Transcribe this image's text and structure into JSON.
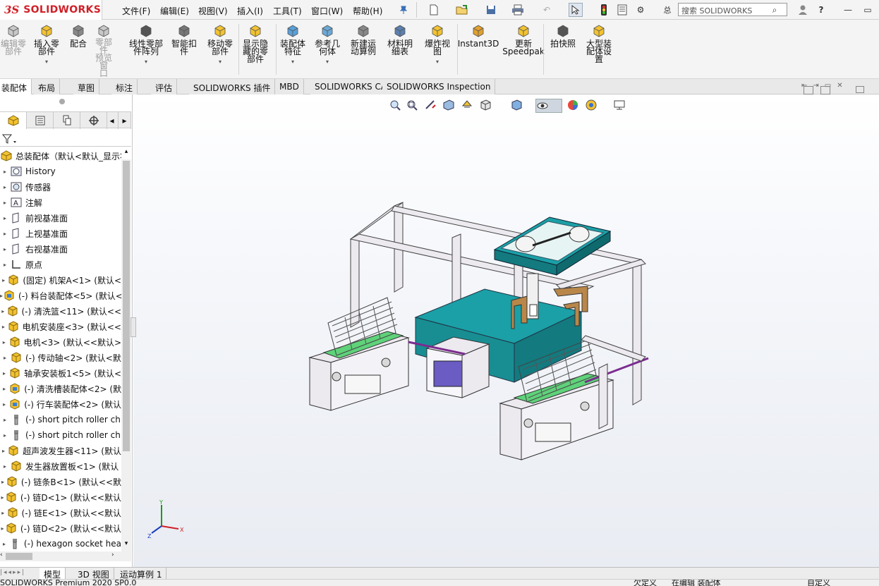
{
  "app": {
    "logo_ds": "3S",
    "logo_name": "SOLIDWORKS"
  },
  "menu": [
    "文件(F)",
    "编辑(E)",
    "视图(V)",
    "插入(I)",
    "工具(T)",
    "窗口(W)",
    "帮助(H)"
  ],
  "search": {
    "text": "搜索 SOLIDWORKS",
    "truncated_label": "总"
  },
  "commands": [
    {
      "label": "编辑零\n部件",
      "icon": "edit-component-icon",
      "disabled": true
    },
    {
      "label": "插入零\n部件",
      "icon": "insert-component-icon",
      "caret": true
    },
    {
      "label": "配合",
      "icon": "mate-icon"
    },
    {
      "label": "零部件\n预览窗\n口",
      "icon": "component-preview-icon",
      "disabled": true
    },
    {
      "label": "线性零部\n件阵列",
      "icon": "linear-pattern-icon",
      "caret": true
    },
    {
      "label": "智能扣\n件",
      "icon": "smart-fasteners-icon"
    },
    {
      "label": "移动零\n部件",
      "icon": "move-component-icon",
      "caret": true
    },
    {
      "label": "显示隐\n藏的零\n部件",
      "icon": "show-hidden-icon"
    },
    {
      "label": "装配体\n特征",
      "icon": "assembly-features-icon",
      "caret": true
    },
    {
      "label": "参考几\n何体",
      "icon": "reference-geometry-icon",
      "caret": true
    },
    {
      "label": "新建运\n动算例",
      "icon": "motion-study-icon"
    },
    {
      "label": "材料明\n细表",
      "icon": "bom-icon"
    },
    {
      "label": "爆炸视\n图",
      "icon": "exploded-view-icon",
      "caret": true
    },
    {
      "label": "Instant3D",
      "icon": "instant3d-icon"
    },
    {
      "label": "更新\nSpeedpak",
      "icon": "speedpak-icon"
    },
    {
      "label": "拍快照",
      "icon": "snapshot-icon"
    },
    {
      "label": "大型装\n配体设\n置",
      "icon": "large-assembly-icon"
    }
  ],
  "tabs": [
    "装配体",
    "布局",
    "草图",
    "标注",
    "评估",
    "SOLIDWORKS 插件",
    "MBD",
    "SOLIDWORKS CAM",
    "SOLIDWORKS Inspection"
  ],
  "tree": [
    {
      "label": "总装配体（默认<默认_显示状",
      "icon": "assembly-icon",
      "level": 0
    },
    {
      "label": "History",
      "icon": "history-icon",
      "level": 1
    },
    {
      "label": "传感器",
      "icon": "sensor-icon",
      "level": 1
    },
    {
      "label": "注解",
      "icon": "annotations-icon",
      "level": 1
    },
    {
      "label": "前视基准面",
      "icon": "plane-icon",
      "level": 1
    },
    {
      "label": "上视基准面",
      "icon": "plane-icon",
      "level": 1
    },
    {
      "label": "右视基准面",
      "icon": "plane-icon",
      "level": 1
    },
    {
      "label": "原点",
      "icon": "origin-icon",
      "level": 1
    },
    {
      "label": "(固定) 机架A<1> (默认<",
      "icon": "part-icon",
      "level": 1
    },
    {
      "label": "(-) 料台装配体<5> (默认<",
      "icon": "subassembly-icon",
      "level": 1
    },
    {
      "label": "(-) 清洗篮<11> (默认<<",
      "icon": "part-icon",
      "level": 1
    },
    {
      "label": "电机安装座<3> (默认<<",
      "icon": "part-icon",
      "level": 1
    },
    {
      "label": "电机<3> (默认<<默认>",
      "icon": "part-icon",
      "level": 1
    },
    {
      "label": "(-) 传动轴<2> (默认<默",
      "icon": "part-icon",
      "level": 1
    },
    {
      "label": "轴承安装板1<5> (默认<",
      "icon": "part-icon",
      "level": 1
    },
    {
      "label": "(-) 清洗槽装配体<2> (默",
      "icon": "subassembly-icon",
      "level": 1
    },
    {
      "label": "(-) 行车装配体<2> (默认",
      "icon": "subassembly-icon",
      "level": 1
    },
    {
      "label": "(-) short pitch roller ch",
      "icon": "toolbox-icon",
      "level": 1
    },
    {
      "label": "(-) short pitch roller ch",
      "icon": "toolbox-icon",
      "level": 1
    },
    {
      "label": "超声波发生器<11> (默认",
      "icon": "part-icon",
      "level": 1
    },
    {
      "label": "发生器放置板<1> (默认",
      "icon": "part-icon",
      "level": 1
    },
    {
      "label": "(-) 链条B<1> (默认<<默",
      "icon": "part-icon",
      "level": 1
    },
    {
      "label": "(-) 链D<1> (默认<<默认",
      "icon": "part-icon",
      "level": 1
    },
    {
      "label": "(-) 链E<1> (默认<<默认",
      "icon": "part-icon",
      "level": 1
    },
    {
      "label": "(-) 链D<2> (默认<<默认",
      "icon": "part-icon",
      "level": 1
    },
    {
      "label": "(-) hexagon socket hea",
      "icon": "toolbox-icon",
      "level": 1
    }
  ],
  "triad": {
    "x": "X",
    "y": "Y",
    "z": "Z"
  },
  "bottom_tabs": [
    "模型",
    "3D 视图",
    "运动算例 1"
  ],
  "status": {
    "left": "SOLIDWORKS Premium 2020 SP0.0",
    "r1": "欠定义",
    "r2": "在编辑 装配体",
    "r3": "自定义"
  },
  "colors": {
    "accent_red": "#d02027",
    "teal": "#1aa0a6",
    "green": "#5fd27a",
    "frame": "#ece9ef",
    "purple": "#7b6cc9"
  }
}
